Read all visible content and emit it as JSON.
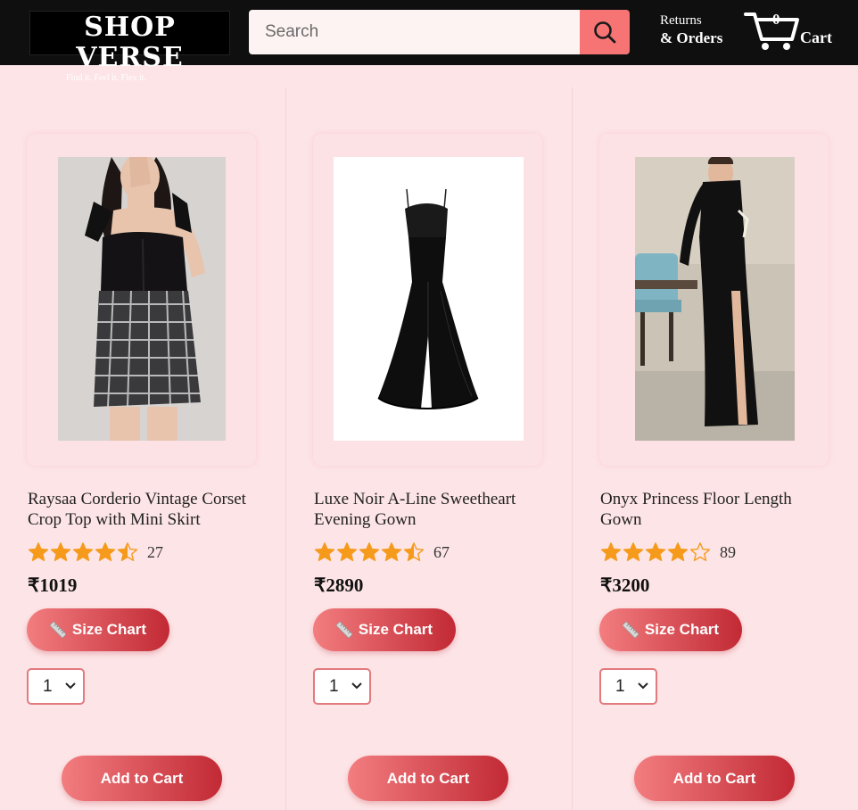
{
  "header": {
    "logo_title": "SHOP VERSE",
    "logo_tagline": "Find it. Feel it. Flex it.",
    "search_placeholder": "Search",
    "returns_line1": "Returns",
    "returns_line2": "& Orders",
    "cart_count": "0",
    "cart_label": "Cart"
  },
  "colors": {
    "page_bg": "#fde4e6",
    "header_bg": "#0f0f0f",
    "accent": "#f77474",
    "button_gradient_start": "#f27d7f",
    "button_gradient_end": "#c22a35",
    "star": "#f59a1b"
  },
  "products": [
    {
      "title": "Raysaa Corderio Vintage Corset Crop Top with Mini Skirt",
      "rating": 4.5,
      "rating_count": "27",
      "price": "₹1019",
      "size_chart_label": "Size Chart",
      "quantity": "1",
      "add_to_cart_label": "Add to Cart",
      "image_icon": "product-photo-corset-top-skirt"
    },
    {
      "title": "Luxe Noir A-Line Sweetheart Evening Gown",
      "rating": 4.5,
      "rating_count": "67",
      "price": "₹2890",
      "size_chart_label": "Size Chart",
      "quantity": "1",
      "add_to_cart_label": "Add to Cart",
      "image_icon": "product-photo-black-gown"
    },
    {
      "title": "Onyx Princess Floor Length Gown",
      "rating": 4,
      "rating_count": "89",
      "price": "₹3200",
      "size_chart_label": "Size Chart",
      "quantity": "1",
      "add_to_cart_label": "Add to Cart",
      "image_icon": "product-photo-one-shoulder-gown"
    }
  ]
}
